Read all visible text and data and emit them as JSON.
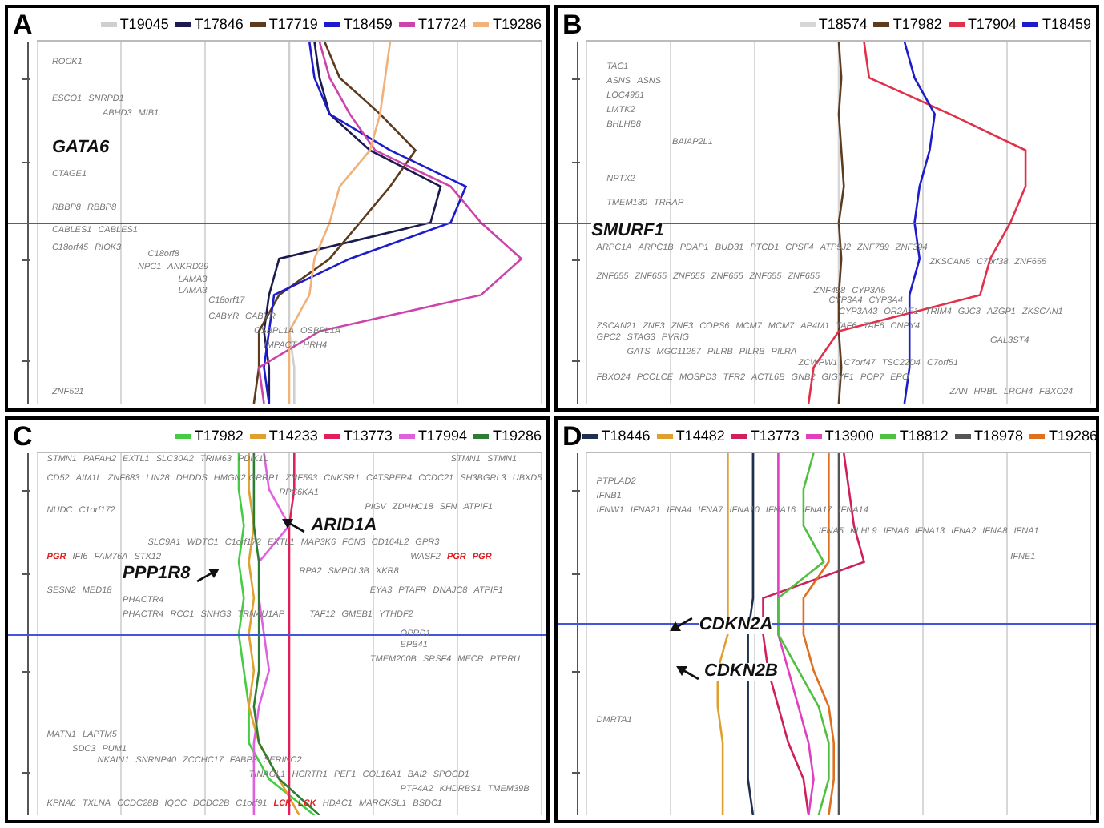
{
  "panels": [
    {
      "letter": "A",
      "legend": [
        {
          "name": "T19045",
          "color": "#cfcfcf"
        },
        {
          "name": "T17846",
          "color": "#1b1b4f"
        },
        {
          "name": "T17719",
          "color": "#5c3b1e"
        },
        {
          "name": "T18459",
          "color": "#1c1ccc"
        },
        {
          "name": "T17724",
          "color": "#cc44aa"
        },
        {
          "name": "T19286",
          "color": "#f0b27a"
        }
      ],
      "gene_rows": [
        [
          "ROCK1"
        ],
        [
          "ESCO1",
          "SNRPD1"
        ],
        [
          "ABHD3",
          "MIB1"
        ],
        [
          "CTAGE1"
        ],
        [
          "RBBP8",
          "RBBP8"
        ],
        [
          "CABLES1",
          "CABLES1"
        ],
        [
          "C18orf45",
          "RIOK3"
        ],
        [
          "C18orf8"
        ],
        [
          "NPC1",
          "ANKRD29"
        ],
        [
          "LAMA3"
        ],
        [
          "LAMA3"
        ],
        [
          "C18orf17"
        ],
        [
          "CABYR",
          "CABYR"
        ],
        [
          "OSBPL1A",
          "OSBPL1A"
        ],
        [
          "IMPACT",
          "HRH4"
        ],
        [
          "ZNF521"
        ]
      ],
      "callouts": [
        {
          "name": "GATA6",
          "kind": "plain"
        }
      ]
    },
    {
      "letter": "B",
      "legend": [
        {
          "name": "T18574",
          "color": "#d6d6d6"
        },
        {
          "name": "T17982",
          "color": "#5c3b1e"
        },
        {
          "name": "T17904",
          "color": "#e0304a"
        },
        {
          "name": "T18459",
          "color": "#1c1ccc"
        }
      ],
      "gene_rows": [
        [
          "TAC1"
        ],
        [
          "ASNS",
          "ASNS"
        ],
        [
          "LOC4951"
        ],
        [
          "LMTK2"
        ],
        [
          "BHLHB8"
        ],
        [
          "BAIAP2L1"
        ],
        [
          "NPTX2"
        ],
        [
          "TMEM130",
          "TRRAP"
        ],
        [
          "ARPC1A",
          "ARPC1B",
          "PDAP1",
          "BUD31",
          "PTCD1",
          "CPSF4",
          "ATP5J2",
          "ZNF789",
          "ZNF394"
        ],
        [
          "ZKSCAN5",
          "C7orf38",
          "ZNF655"
        ],
        [
          "ZNF655",
          "ZNF655",
          "ZNF655",
          "ZNF655",
          "ZNF655",
          "ZNF655"
        ],
        [
          "ZNF498",
          "CYP3A5"
        ],
        [
          "CYP3A4",
          "CYP3A4"
        ],
        [
          "CYP3A43",
          "OR2AE1",
          "TRIM4",
          "GJC3",
          "AZGP1",
          "ZKSCAN1"
        ],
        [
          "ZSCAN21",
          "ZNF3",
          "ZNF3",
          "COPS6",
          "MCM7",
          "MCM7",
          "AP4M1",
          "TAF6",
          "TAF6",
          "CNPY4"
        ],
        [
          "GAL3ST4"
        ],
        [
          "GPC2",
          "STAG3",
          "PVRIG"
        ],
        [
          "GATS",
          "MGC11257",
          "PILRB",
          "PILRB",
          "PILRA"
        ],
        [
          "ZCWPW1",
          "C7orf47",
          "TSC22D4",
          "C7orf51"
        ],
        [
          "FBXO24",
          "PCOLCE",
          "MOSPD3",
          "TFR2",
          "ACTL6B",
          "GNB2",
          "GIGYF1",
          "POP7",
          "EPO"
        ],
        [
          "ZAN",
          "HRBL",
          "LRCH4",
          "FBXO24"
        ]
      ],
      "callouts": [
        {
          "name": "SMURF1",
          "kind": "plain"
        }
      ]
    },
    {
      "letter": "C",
      "legend": [
        {
          "name": "T17982",
          "color": "#44cc44"
        },
        {
          "name": "T14233",
          "color": "#e0a030"
        },
        {
          "name": "T13773",
          "color": "#e0205a"
        },
        {
          "name": "T17994",
          "color": "#e060e0"
        },
        {
          "name": "T19286",
          "color": "#2e7d32"
        }
      ],
      "gene_rows": [
        [
          "STMN1",
          "PAFAH2",
          "EXTL1",
          "SLC30A2",
          "TRIM63",
          "PDIK1L"
        ],
        [
          "STMN1",
          "STMN1"
        ],
        [
          "CD52",
          "AIM1L",
          "ZNF683",
          "LIN28",
          "DHDDS",
          "HMGN2"
        ],
        [
          "GRRP1",
          "ZNF593",
          "CNKSR1",
          "CATSPER4",
          "CCDC21",
          "SH3BGRL3",
          "UBXD5"
        ],
        [
          "RPS6KA1"
        ],
        [
          "NUDC",
          "C1orf172"
        ],
        [
          "PIGV",
          "ZDHHC18",
          "SFN",
          "ATPIF1"
        ],
        [
          "SLC9A1",
          "WDTC1",
          "C1orf172",
          "EXTL1",
          "MAP3K6",
          "FCN3",
          "CD164L2",
          "GPR3"
        ],
        [
          {
            "name": "PGR",
            "kind": "alert"
          },
          {
            "name": "IFI6",
            "kind": "gene"
          },
          {
            "name": "FAM76A",
            "kind": "gene"
          },
          {
            "name": "STX12",
            "kind": "gene"
          }
        ],
        [
          "WASF2",
          {
            "name": "PGR",
            "kind": "alert"
          },
          {
            "name": "PGR",
            "kind": "alert"
          }
        ],
        [
          "RPA2",
          "SMPDL3B",
          "XKR8"
        ],
        [
          "SESN2",
          "MED18"
        ],
        [
          "EYA3",
          "PTAFR",
          "DNAJC8",
          "ATPIF1"
        ],
        [
          "PHACTR4"
        ],
        [
          "PHACTR4",
          "RCC1",
          "SNHG3",
          "TRNAU1AP"
        ],
        [
          "TAF12",
          "GMEB1",
          "YTHDF2"
        ],
        [
          "OPRD1"
        ],
        [
          "EPB41"
        ],
        [
          "TMEM200B",
          "SRSF4",
          "MECR",
          "PTPRU"
        ],
        [
          "MATN1",
          "LAPTM5"
        ],
        [
          "SDC3",
          "PUM1"
        ],
        [
          "NKAIN1",
          "SNRNP40",
          "ZCCHC17",
          "FABP3",
          "SERINC2"
        ],
        [
          "TINAGL1",
          "HCRTR1",
          "PEF1",
          "COL16A1",
          "BAI2",
          "SPOCD1"
        ],
        [
          "PTP4A2",
          "KHDRBS1",
          "TMEM39B"
        ],
        [
          "KPNA6",
          "TXLNA",
          "CCDC28B",
          "IQCC",
          "DCDC2B",
          "C1orf91",
          {
            "name": "LCK",
            "kind": "alert"
          },
          {
            "name": "LCK",
            "kind": "alert"
          },
          "HDAC1",
          "MARCKSL1",
          "BSDC1"
        ]
      ],
      "callouts": [
        {
          "name": "ARID1A",
          "kind": "arrow-nw"
        },
        {
          "name": "PPP1R8",
          "kind": "arrow-ne"
        }
      ]
    },
    {
      "letter": "D",
      "legend": [
        {
          "name": "T18446",
          "color": "#1f2f4f"
        },
        {
          "name": "T14482",
          "color": "#e0a030"
        },
        {
          "name": "T13773",
          "color": "#d0205a"
        },
        {
          "name": "T13900",
          "color": "#e040c0"
        },
        {
          "name": "T18812",
          "color": "#50c040"
        },
        {
          "name": "T18978",
          "color": "#555555"
        },
        {
          "name": "T19286",
          "color": "#e07020"
        }
      ],
      "gene_rows": [
        [
          "PTPLAD2"
        ],
        [
          "IFNB1"
        ],
        [
          "IFNW1",
          "IFNA21",
          "IFNA4",
          "IFNA7",
          "IFNA10",
          "IFNA16",
          "IFNA17",
          "IFNA14"
        ],
        [
          "IFNA5",
          "KLHL9",
          "IFNA6",
          "IFNA13",
          "IFNA2",
          "IFNA8",
          "IFNA1"
        ],
        [
          "IFNE1"
        ],
        [
          "DMRTA1"
        ]
      ],
      "callouts": [
        {
          "name": "CDKN2A",
          "kind": "arrow-sw"
        },
        {
          "name": "CDKN2B",
          "kind": "arrow-nw"
        }
      ]
    }
  ]
}
